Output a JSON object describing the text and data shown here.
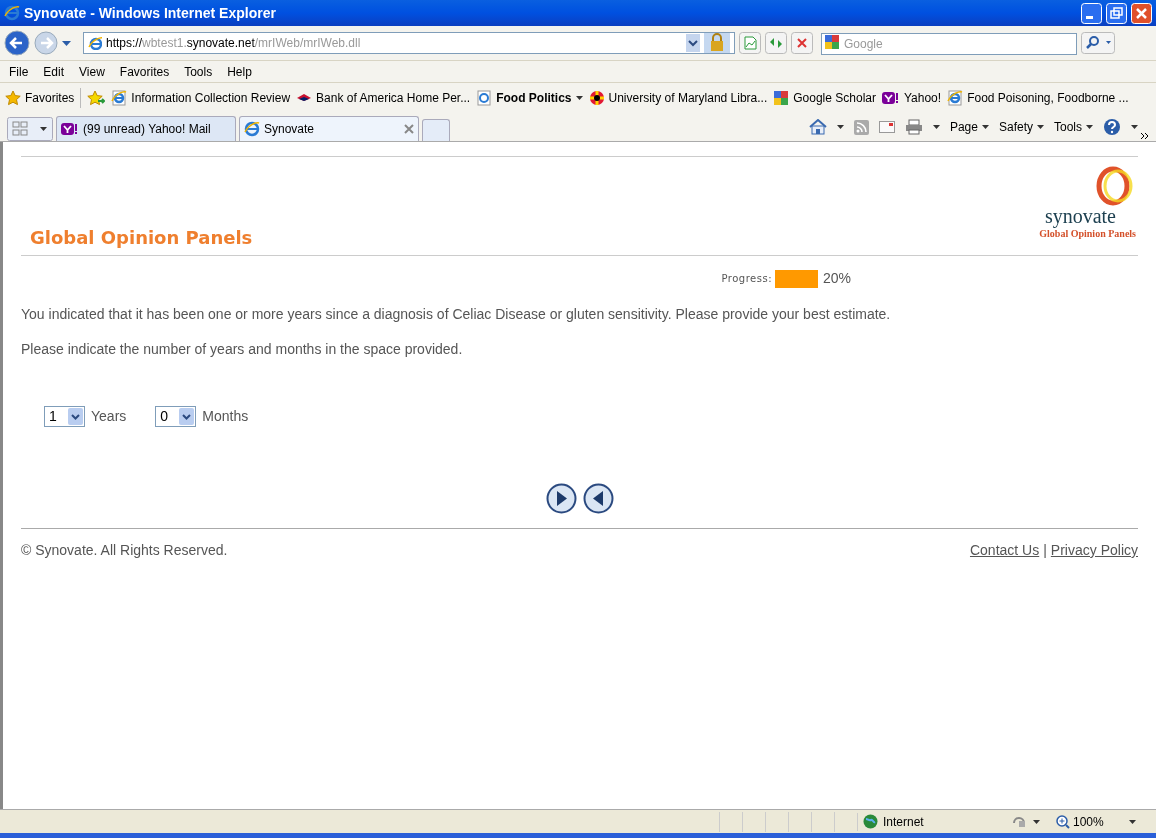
{
  "window": {
    "title": "Synovate - Windows Internet Explorer"
  },
  "address_bar": {
    "url_parts": [
      {
        "text": "https://",
        "dim": false
      },
      {
        "text": "wbtest1.",
        "dim": true
      },
      {
        "text": "synovate.net",
        "dim": false
      },
      {
        "text": "/mrIWeb/mrIWeb.dll",
        "dim": true
      }
    ]
  },
  "search": {
    "placeholder": "Google"
  },
  "menu": [
    "File",
    "Edit",
    "View",
    "Favorites",
    "Tools",
    "Help"
  ],
  "favorites_bar": {
    "label": "Favorites",
    "items": [
      {
        "label": "Information Collection Review",
        "kind": "page",
        "bold": false
      },
      {
        "label": "Bank of America  Home  Per...",
        "kind": "flag",
        "bold": false
      },
      {
        "label": "Food Politics",
        "kind": "folder",
        "bold": true
      },
      {
        "label": "University of Maryland Libra...",
        "kind": "crest",
        "bold": false
      },
      {
        "label": "Google Scholar",
        "kind": "google",
        "bold": false
      },
      {
        "label": "Yahoo!",
        "kind": "yahoo",
        "bold": false
      },
      {
        "label": "Food Poisoning, Foodborne ...",
        "kind": "page",
        "bold": false
      }
    ]
  },
  "tabs": [
    {
      "label": "(99 unread) Yahoo! Mail",
      "kind": "yahoo",
      "selected": false
    },
    {
      "label": "Synovate",
      "kind": "page",
      "selected": true
    }
  ],
  "command_bar": [
    "Page",
    "Safety",
    "Tools"
  ],
  "page": {
    "header_title": "Global Opinion Panels",
    "logo_word": "synovate",
    "logo_tagline": "Global Opinion Panels",
    "progress": {
      "label": "Progress:",
      "level": 0.2,
      "reading": "20%"
    },
    "paragraphs": [
      "You indicated that it has been one or more years since a diagnosis of Celiac Disease or gluten sensitivity. Please provide your best estimate.",
      "Please indicate the number of years and months in the space provided."
    ],
    "fields": [
      {
        "value": "1",
        "label": "Years"
      },
      {
        "value": "0",
        "label": "Months"
      }
    ],
    "footer": {
      "copyright": "© Synovate. All Rights Reserved.",
      "links": [
        "Contact Us",
        "Privacy Policy"
      ],
      "separator": "|"
    }
  },
  "status_bar": {
    "zone": "Internet",
    "zoom": "100%"
  }
}
